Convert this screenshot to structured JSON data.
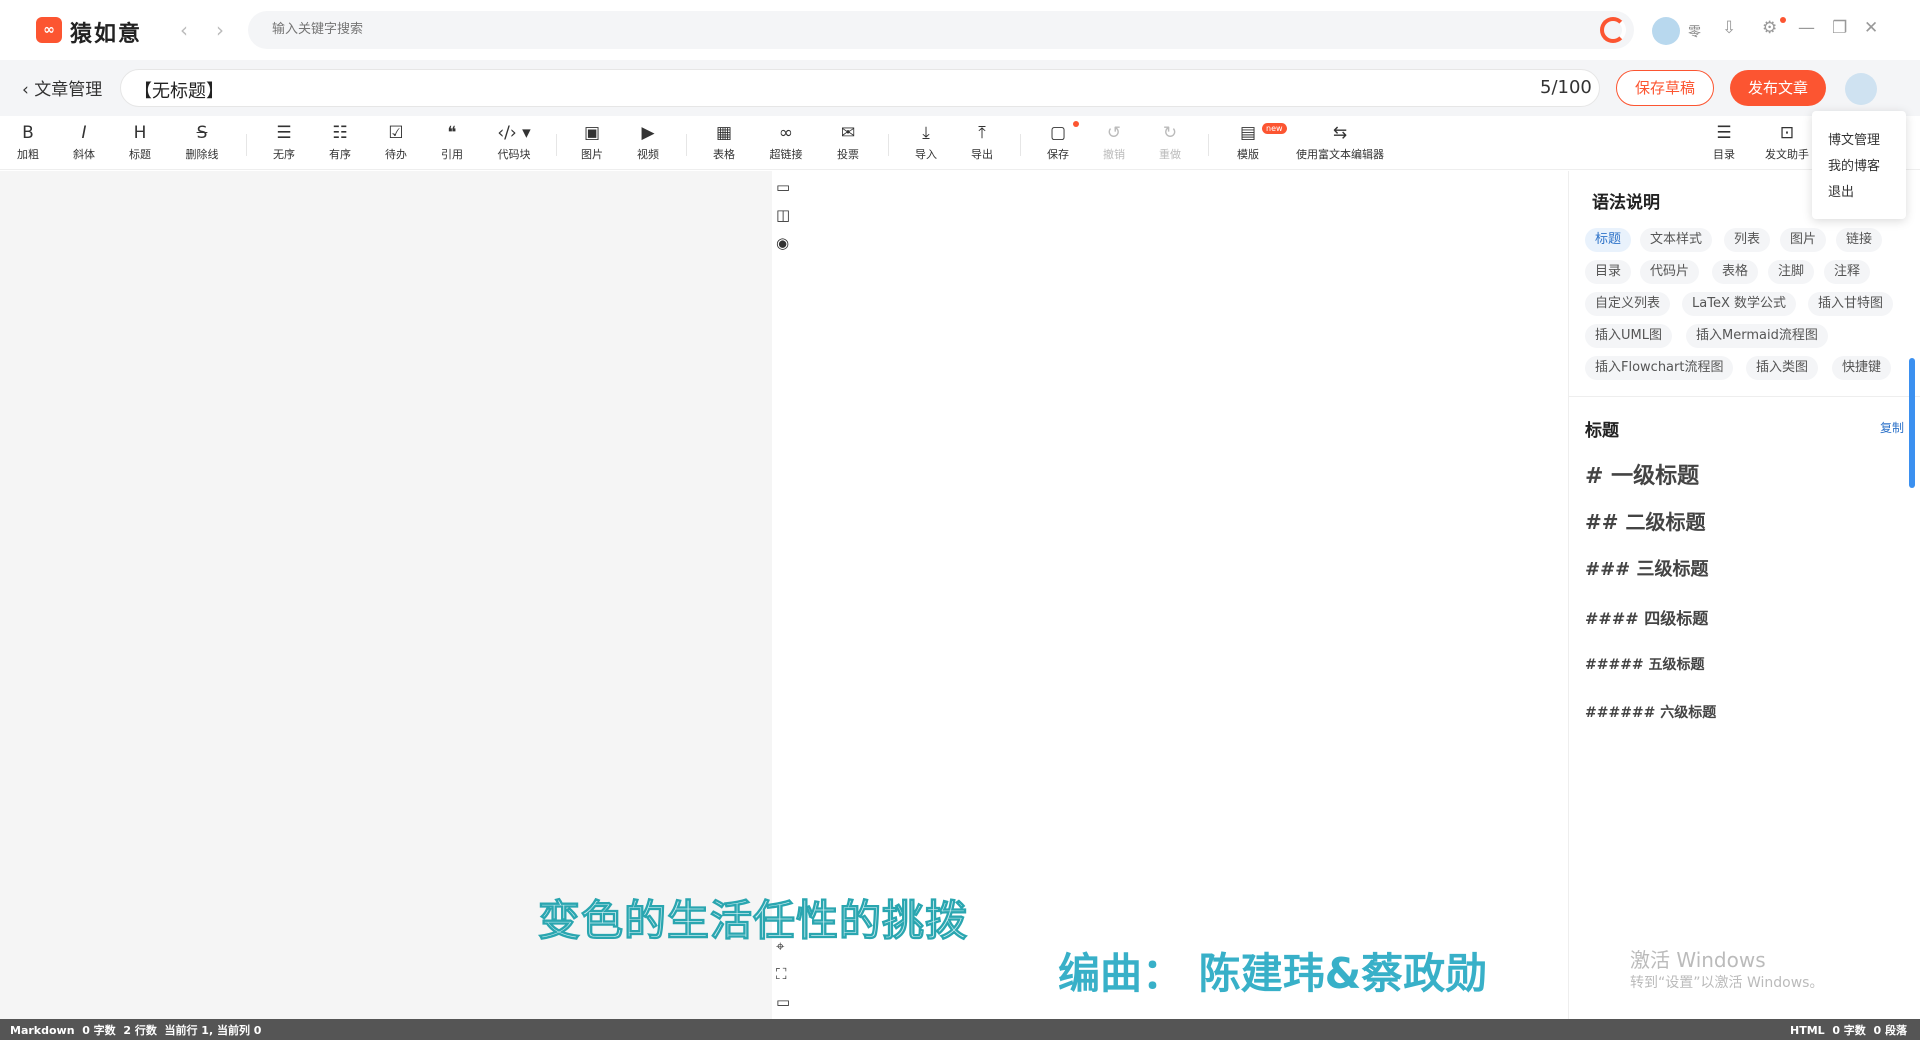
{
  "app": {
    "title": "猿如意",
    "logo_text": "∞"
  },
  "nav": {
    "back_arrow": "‹",
    "forward_arrow": "›"
  },
  "search": {
    "placeholder": "输入关键字搜索"
  },
  "topbar": {
    "user_name": "零",
    "icons": [
      "csdn-logo",
      "download-icon",
      "settings-icon",
      "minimize-icon",
      "restore-icon",
      "close-icon"
    ]
  },
  "header": {
    "back_label": "‹ 文章管理",
    "title_value": "【无标题】",
    "title_count": "5/100",
    "save_draft": "保存草稿",
    "publish": "发布文章"
  },
  "toolbar": {
    "items": [
      {
        "icon": "B",
        "label": "加粗"
      },
      {
        "icon": "I",
        "label": "斜体"
      },
      {
        "icon": "H",
        "label": "标题"
      },
      {
        "icon": "S",
        "label": "删除线"
      },
      {
        "icon": "☰",
        "label": "无序"
      },
      {
        "icon": "☷",
        "label": "有序"
      },
      {
        "icon": "☑",
        "label": "待办"
      },
      {
        "icon": "❝",
        "label": "引用"
      },
      {
        "icon": "‹/› ▾",
        "label": "代码块"
      },
      {
        "icon": "▣",
        "label": "图片"
      },
      {
        "icon": "▶",
        "label": "视频"
      },
      {
        "icon": "▦",
        "label": "表格"
      },
      {
        "icon": "∞",
        "label": "超链接"
      },
      {
        "icon": "✉",
        "label": "投票"
      },
      {
        "icon": "⤓",
        "label": "导入"
      },
      {
        "icon": "⤒",
        "label": "导出"
      },
      {
        "icon": "▢",
        "label": "保存"
      },
      {
        "icon": "↺",
        "label": "撤销"
      },
      {
        "icon": "↻",
        "label": "重做"
      },
      {
        "icon": "▤",
        "label": "模版"
      },
      {
        "icon": "⇆",
        "label": "使用富文本编辑器"
      },
      {
        "icon": "☰",
        "label": "目录"
      },
      {
        "icon": "⊡",
        "label": "发文助手"
      }
    ],
    "new_badge": "new"
  },
  "dropdown": {
    "items": [
      "博文管理",
      "我的博客",
      "退出"
    ]
  },
  "syntax": {
    "title": "语法说明",
    "tags": [
      "标题",
      "文本样式",
      "列表",
      "图片",
      "链接",
      "目录",
      "代码片",
      "表格",
      "注脚",
      "注释",
      "自定义列表",
      "LaTeX 数学公式",
      "插入甘特图",
      "插入UML图",
      "插入Mermaid流程图",
      "插入Flowchart流程图",
      "插入类图",
      "快捷键"
    ],
    "section_title": "标题",
    "copy": "复制",
    "headings": [
      "# 一级标题",
      "## 二级标题",
      "### 三级标题",
      "#### 四级标题",
      "##### 五级标题",
      "###### 六级标题"
    ]
  },
  "overlay": {
    "subtitle_left": "变色的生活任性的挑拨",
    "subtitle_right": "编曲： 陈建玮&蔡政勋",
    "activate_title": "激活 Windows",
    "activate_sub": "转到“设置”以激活 Windows。"
  },
  "status": {
    "left": "Markdown  0 字数  2 行数  当前行 1, 当前列 0",
    "right": "HTML  0 字数  0 段落"
  }
}
